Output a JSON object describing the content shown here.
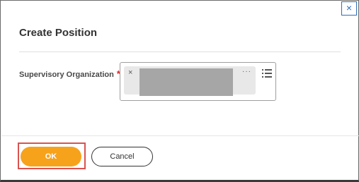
{
  "dialog": {
    "title": "Create Position",
    "close_glyph": "×"
  },
  "form": {
    "supervisory_org": {
      "label": "Supervisory Organization",
      "required_marker": "*",
      "remove_glyph": "×",
      "more_glyph": "···",
      "selected_value_redacted": true
    }
  },
  "footer": {
    "ok_label": "OK",
    "cancel_label": "Cancel"
  },
  "colors": {
    "ok_button": "#f7a21b",
    "required_marker": "#d9262c",
    "highlight_border": "#d9534f",
    "close_border": "#2a6ebb"
  },
  "icons": [
    "close-icon",
    "remove-icon",
    "more-options-icon",
    "list-icon"
  ]
}
